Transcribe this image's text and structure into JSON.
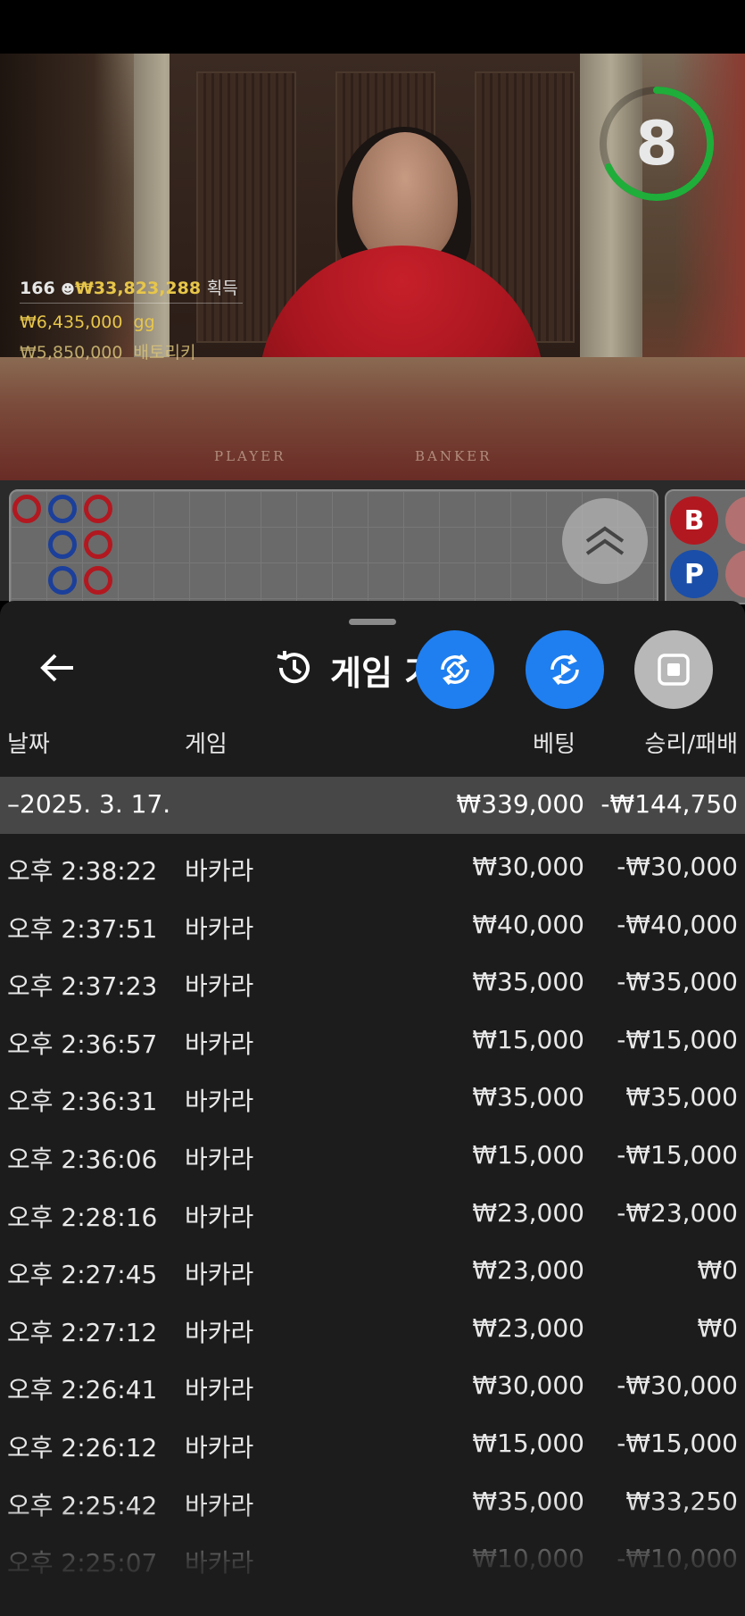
{
  "video": {
    "timer": "8",
    "table_labels": {
      "player": "PLAYER",
      "banker": "BANKER"
    },
    "stats": {
      "players": "166",
      "total": "₩33,823,288",
      "total_suffix": "획득",
      "winner1_amount": "₩6,435,000",
      "winner1_name": "gg",
      "winner2_amount": "₩5,850,000",
      "winner2_name": "배토리키"
    }
  },
  "road": {
    "side_labels": {
      "banker": "B",
      "player": "P"
    }
  },
  "history": {
    "title": "게임 기",
    "columns": {
      "date": "날짜",
      "game": "게임",
      "bet": "베팅",
      "result": "승리/패배"
    },
    "group": {
      "date": "–2025. 3. 17.",
      "bet": "₩339,000",
      "result": "-₩144,750"
    },
    "rows": [
      {
        "time": "오후 2:38:22",
        "game": "바카라",
        "bet": "₩30,000",
        "result": "-₩30,000"
      },
      {
        "time": "오후 2:37:51",
        "game": "바카라",
        "bet": "₩40,000",
        "result": "-₩40,000"
      },
      {
        "time": "오후 2:37:23",
        "game": "바카라",
        "bet": "₩35,000",
        "result": "-₩35,000"
      },
      {
        "time": "오후 2:36:57",
        "game": "바카라",
        "bet": "₩15,000",
        "result": "-₩15,000"
      },
      {
        "time": "오후 2:36:31",
        "game": "바카라",
        "bet": "₩35,000",
        "result": "₩35,000"
      },
      {
        "time": "오후 2:36:06",
        "game": "바카라",
        "bet": "₩15,000",
        "result": "-₩15,000"
      },
      {
        "time": "오후 2:28:16",
        "game": "바카라",
        "bet": "₩23,000",
        "result": "-₩23,000"
      },
      {
        "time": "오후 2:27:45",
        "game": "바카라",
        "bet": "₩23,000",
        "result": "₩0"
      },
      {
        "time": "오후 2:27:12",
        "game": "바카라",
        "bet": "₩23,000",
        "result": "₩0"
      },
      {
        "time": "오후 2:26:41",
        "game": "바카라",
        "bet": "₩30,000",
        "result": "-₩30,000"
      },
      {
        "time": "오후 2:26:12",
        "game": "바카라",
        "bet": "₩15,000",
        "result": "-₩15,000"
      },
      {
        "time": "오후 2:25:42",
        "game": "바카라",
        "bet": "₩35,000",
        "result": "₩33,250"
      },
      {
        "time": "오후 2:25:07",
        "game": "바카라",
        "bet": "₩10,000",
        "result": "-₩10,000"
      }
    ]
  },
  "colors": {
    "accent": "#1f7ff0",
    "timer_ring": "#1fae3a",
    "banker": "#b21820",
    "player": "#1b4ea8"
  }
}
